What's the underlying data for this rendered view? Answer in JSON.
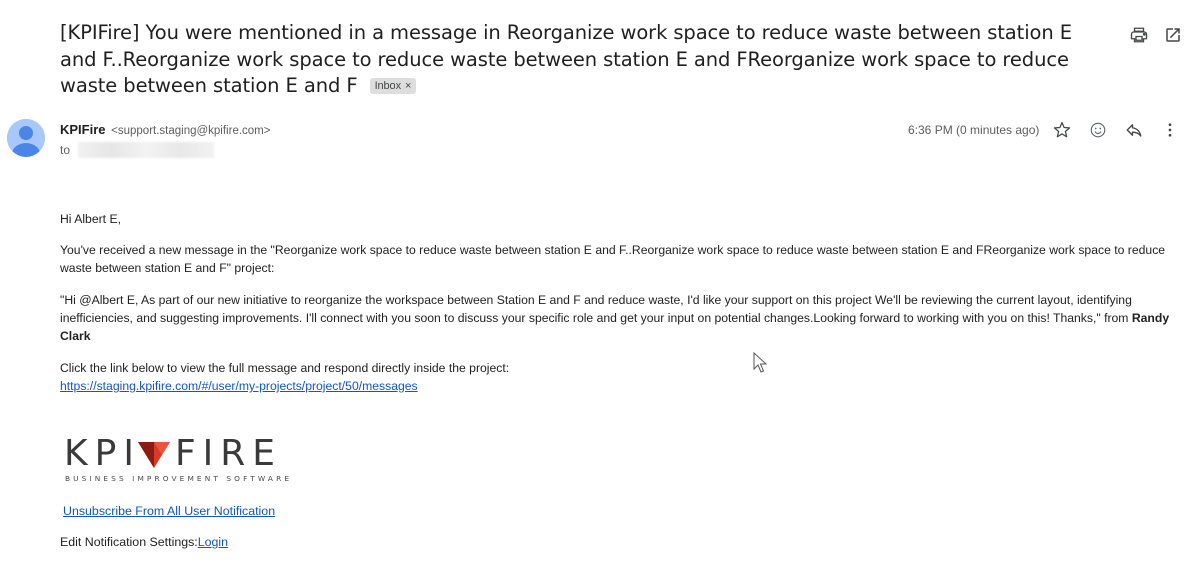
{
  "email": {
    "subject": "[KPIFire] You were mentioned in a message in Reorganize work space to reduce waste between station E and F..Reorganize work space to reduce waste between station E and FReorganize work space to reduce waste between station E and F",
    "label": "Inbox",
    "label_remove": "×",
    "sender_name": "KPIFire",
    "sender_email": "<support.staging@kpifire.com>",
    "to_label": "to",
    "time": "6:36 PM (0 minutes ago)"
  },
  "toolbar": {
    "print_icon": "printer-icon",
    "popout_icon": "open-in-new-window-icon",
    "star_icon": "star-icon",
    "emoji_icon": "add-emoji-icon",
    "reply_icon": "reply-icon",
    "more_icon": "more-vertical-icon"
  },
  "body": {
    "greeting": "Hi Albert E,",
    "intro": "You've received a new message in the \"Reorganize work space to reduce waste between station E and F..Reorganize work space to reduce waste between station E and FReorganize work space to reduce waste between station E and F\" project:",
    "quote": "\"Hi @Albert E, As part of our new initiative to reorganize the workspace between Station E and F and reduce waste, I'd like your support on this project We'll be reviewing the current layout, identifying inefficiencies, and suggesting improvements. I'll connect with you soon to discuss your specific role and get your input on potential changes.Looking forward to working with you on this! Thanks,\" from ",
    "quote_author": "Randy Clark",
    "cta": "Click the link below to view the full message and respond directly inside the project:",
    "link": "https://staging.kpifire.com/#/user/my-projects/project/50/messages"
  },
  "logo": {
    "word_left": "KPI",
    "word_right": "FIRE",
    "tagline": "BUSINESS IMPROVEMENT SOFTWARE",
    "colors": {
      "text": "#3a3a3a",
      "mark_red": "#d93a27",
      "mark_dark": "#8e1b12"
    }
  },
  "footer": {
    "unsubscribe": "Unsubscribe From All User Notification",
    "edit_label": "Edit Notification Settings:",
    "login": "Login"
  },
  "colors": {
    "link": "#1155cc",
    "avatar_bg": "#a8c7fa",
    "avatar_fg": "#4a86e8"
  }
}
